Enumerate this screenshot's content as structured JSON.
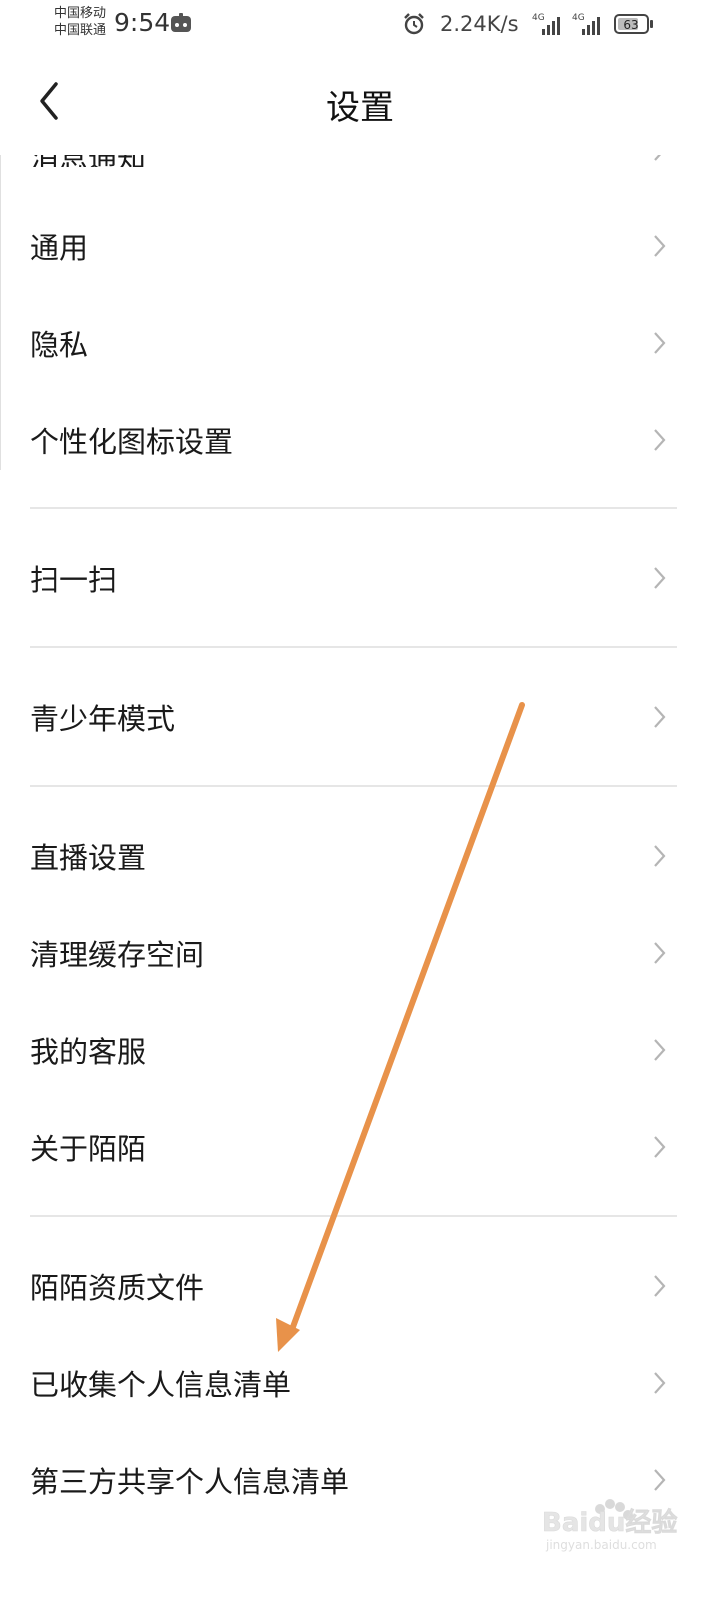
{
  "status_bar": {
    "carrier_1": "中国移动",
    "carrier_2": "中国联通",
    "time": "9:54",
    "net_speed": "2.24K/s",
    "network_type": "4G",
    "battery": "63"
  },
  "header": {
    "title": "设置"
  },
  "list": {
    "partial_item": "消息通知",
    "items": [
      "通用",
      "隐私",
      "个性化图标设置",
      "扫一扫",
      "青少年模式",
      "直播设置",
      "清理缓存空间",
      "我的客服",
      "关于陌陌",
      "陌陌资质文件",
      "已收集个人信息清单",
      "第三方共享个人信息清单"
    ]
  },
  "overlay": {
    "arrow_color": "#E8924A",
    "watermark_brand": "Baidu经验",
    "watermark_url": "jingyan.baidu.com"
  }
}
